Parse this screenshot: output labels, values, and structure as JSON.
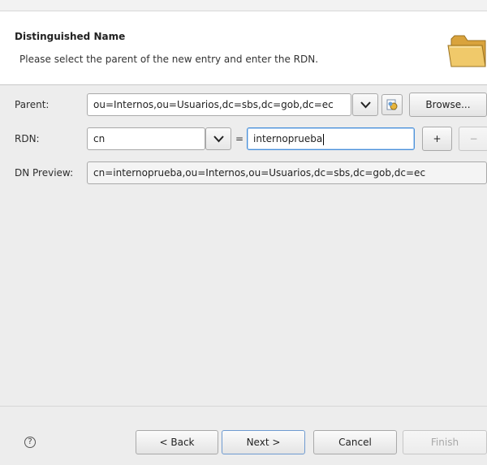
{
  "header": {
    "title": "Distinguished Name",
    "description": "Please select the parent of the new entry and enter the RDN.",
    "icon": "folder-icon"
  },
  "form": {
    "parent_label": "Parent:",
    "parent_value": "ou=Internos,ou=Usuarios,dc=sbs,dc=gob,dc=ec",
    "browse_label": "Browse...",
    "rdn_label": "RDN:",
    "rdn_attribute": "cn",
    "equals": "=",
    "rdn_value": "internoprueba",
    "add_label": "+",
    "remove_label": "−",
    "preview_label": "DN Preview:",
    "preview_value": "cn=internoprueba,ou=Internos,ou=Usuarios,dc=sbs,dc=gob,dc=ec"
  },
  "footer": {
    "help_symbol": "?",
    "back_label": "< Back",
    "next_label": "Next >",
    "cancel_label": "Cancel",
    "finish_label": "Finish"
  },
  "colors": {
    "focus": "#4a90d9",
    "folder": "#f0c96a"
  }
}
